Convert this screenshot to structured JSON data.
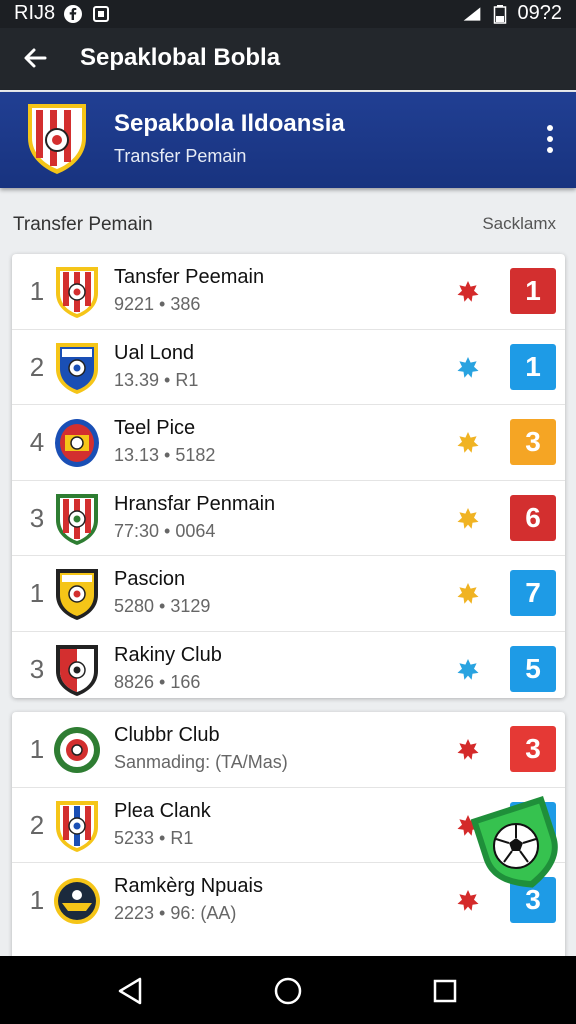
{
  "status_bar": {
    "left_text": "RIJ8",
    "time": "09?2"
  },
  "app_bar": {
    "title": "Sepaklobal Bobla"
  },
  "header": {
    "title": "Sepakbola Ildoansia",
    "subtitle": "Transfer Pemain"
  },
  "section": {
    "label": "Transfer Pemain",
    "action": "Sacklamx"
  },
  "colors": {
    "appbar": "#23272c",
    "header": "#1a3684",
    "red": "#d32f2f",
    "blue": "#1e9be6",
    "orange": "#f5a524"
  },
  "list1": [
    {
      "rank": "1",
      "name": "Tansfer Peemain",
      "meta": "9221 • 386",
      "star_color": "#d42a2a",
      "badge": "1",
      "badge_color": "#d32f2f",
      "logo": "red-white-crest"
    },
    {
      "rank": "2",
      "name": "Ual Lond",
      "meta": "13.39 • R1",
      "star_color": "#29a3e0",
      "badge": "1",
      "badge_color": "#1e9be6",
      "logo": "blue-crest"
    },
    {
      "rank": "4",
      "name": "Teel Pice",
      "meta": "13.13 • 5182",
      "star_color": "#f0b323",
      "badge": "3",
      "badge_color": "#f5a524",
      "logo": "red-blue-oval-crest"
    },
    {
      "rank": "3",
      "name": "Hransfar Penmain",
      "meta": "77:30 • 0064",
      "star_color": "#f0b323",
      "badge": "6",
      "badge_color": "#d32f2f",
      "logo": "green-red-stripe-crest"
    },
    {
      "rank": "1",
      "name": "Pascion",
      "meta": "5280 • 3129",
      "star_color": "#f0b323",
      "badge": "7",
      "badge_color": "#1e9be6",
      "logo": "black-gold-crest"
    },
    {
      "rank": "3",
      "name": "Rakiny Club",
      "meta": "8826 • 166",
      "star_color": "#29a3e0",
      "badge": "5",
      "badge_color": "#1e9be6",
      "logo": "red-white-black-crest"
    }
  ],
  "list2": [
    {
      "rank": "1",
      "name": "Clubbr Club",
      "meta": "Sanmading: (TA/Mas)",
      "star_color": "#d42a2a",
      "badge": "3",
      "badge_color": "#e53935",
      "logo": "green-round-crest"
    },
    {
      "rank": "2",
      "name": "Plea Clank",
      "meta": "5233 • R1",
      "star_color": "#d42a2a",
      "badge": "",
      "badge_color": "#1e9be6",
      "logo": "red-blue-stripe-crest"
    },
    {
      "rank": "1",
      "name": "Ramkèrg Npuais",
      "meta": "2223 • 96: (AA)",
      "star_color": "#d42a2a",
      "badge": "3",
      "badge_color": "#1e9be6",
      "logo": "dark-gold-round-crest"
    }
  ]
}
